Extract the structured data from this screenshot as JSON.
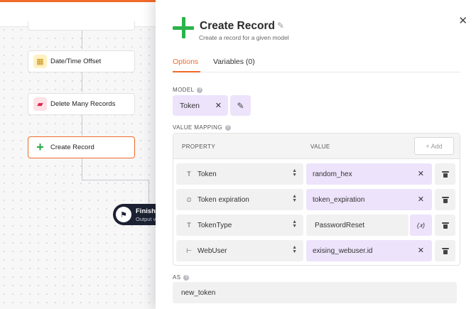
{
  "canvas": {
    "nodes": [
      {
        "label": "Date/Time Offset",
        "icon": "calendar-clock-icon"
      },
      {
        "label": "Delete Many Records",
        "icon": "trash-icon"
      },
      {
        "label": "Create Record",
        "icon": "plus-icon"
      }
    ],
    "finish": {
      "title": "Finish",
      "subtitle": "Output v"
    }
  },
  "panel": {
    "title": "Create Record",
    "subtitle": "Create a record for a given model",
    "tabs": [
      {
        "label": "Options",
        "active": true
      },
      {
        "label": "Variables (0)",
        "active": false
      }
    ],
    "model": {
      "label": "MODEL",
      "value": "Token"
    },
    "value_mapping": {
      "label": "VALUE MAPPING",
      "col_property": "PROPERTY",
      "col_value": "VALUE",
      "add_label": "+ Add",
      "rows": [
        {
          "icon": "T",
          "property": "Token",
          "value": "random_hex",
          "type": "chip"
        },
        {
          "icon": "⏲",
          "property": "Token expiration",
          "value": "token_expiration",
          "type": "chip"
        },
        {
          "icon": "T",
          "property": "TokenType",
          "value": "PasswordReset",
          "type": "plain",
          "fx": "(𝑥)"
        },
        {
          "icon": "⊢",
          "property": "WebUser",
          "value": "exising_webuser.id",
          "type": "chip"
        }
      ]
    },
    "as": {
      "label": "AS",
      "value": "new_token"
    }
  },
  "colors": {
    "accent": "#f06a2a",
    "chip": "#ede3fb",
    "green": "#2bb34a"
  }
}
